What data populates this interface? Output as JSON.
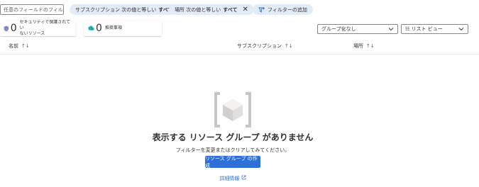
{
  "filter_bar": {
    "search_placeholder": "任意のフィールドのフィルター...",
    "pills": [
      {
        "label": "サブスクリプション 次の値と等しい",
        "value": "すべて"
      },
      {
        "label": "場所 次の値と等しい",
        "value": "すべて",
        "close": "✕"
      }
    ],
    "add_filter": "フィルターの追加"
  },
  "cards": [
    {
      "count": "0",
      "label_line1": "セキュリティで保護されてい",
      "label_line2": "ないリソース"
    },
    {
      "count": "0",
      "label_line1": "推奨事項"
    }
  ],
  "dropdowns": {
    "grouping": "グループ化なし",
    "view": "☷ リスト ビュー"
  },
  "table": {
    "columns": [
      "名前",
      "サブスクリプション",
      "場所"
    ]
  },
  "empty_state": {
    "title": "表示する リソース グループ がありません",
    "description": "フィルターを変更またはクリアしてみてください。",
    "create_button": "リソース グループ の作成",
    "learn_more": "詳細情報"
  },
  "colors": {
    "accent": "#2f6fd8",
    "pill_bg": "#e1ecf7"
  }
}
